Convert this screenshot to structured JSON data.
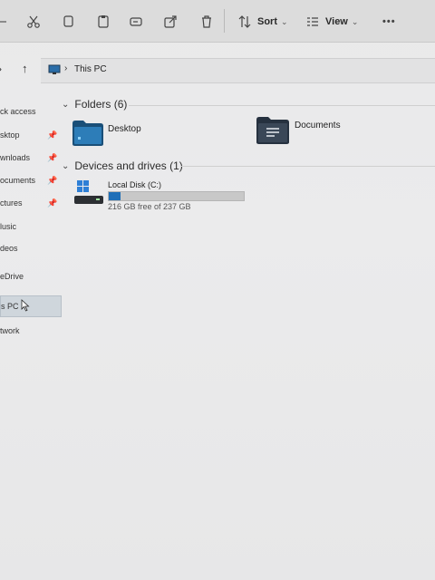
{
  "toolbar": {
    "sort_label": "Sort",
    "view_label": "View",
    "more_label": "•••"
  },
  "address": {
    "location": "This PC"
  },
  "sidebar": {
    "items": [
      {
        "label": "ck access",
        "pinned": false
      },
      {
        "label": "sktop",
        "pinned": true
      },
      {
        "label": "wnloads",
        "pinned": true
      },
      {
        "label": "ocuments",
        "pinned": true
      },
      {
        "label": "ctures",
        "pinned": true
      },
      {
        "label": "lusic",
        "pinned": false
      },
      {
        "label": "deos",
        "pinned": false
      },
      {
        "label": "eDrive",
        "pinned": false
      },
      {
        "label": "s PC",
        "pinned": false,
        "selected": true
      },
      {
        "label": "twork",
        "pinned": false
      }
    ]
  },
  "folders_section": {
    "title": "Folders (6)",
    "folders": [
      {
        "name": "Desktop"
      },
      {
        "name": "Documents"
      }
    ]
  },
  "drives_section": {
    "title": "Devices and drives (1)",
    "drives": [
      {
        "name": "Local Disk (C:)",
        "free_text": "216 GB free of 237 GB",
        "used_fraction": 0.09
      }
    ]
  },
  "colors": {
    "accent": "#1f6fb8",
    "folder_desktop": "#1e5f8e",
    "folder_documents": "#2f3c4d"
  }
}
